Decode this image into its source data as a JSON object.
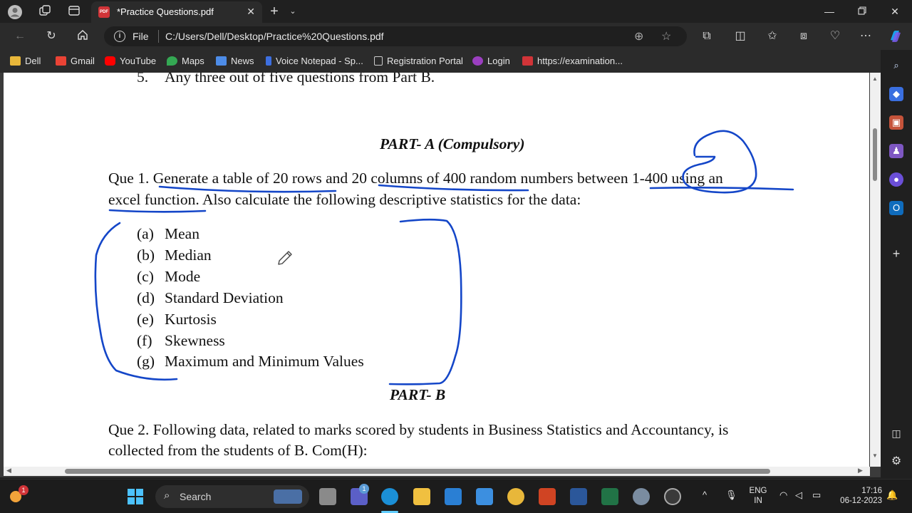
{
  "browser": {
    "tab_title": "*Practice Questions.pdf",
    "address_scheme_label": "File",
    "address_url": "C:/Users/Dell/Desktop/Practice%20Questions.pdf",
    "bookmarks": [
      "Dell",
      "Gmail",
      "YouTube",
      "Maps",
      "News",
      "Voice Notepad - Sp...",
      "Registration Portal",
      "Login",
      "https://examination..."
    ]
  },
  "document": {
    "instruction_5_num": "5.",
    "instruction_5_text": "Any three out of five questions from Part B.",
    "part_a_heading": "PART- A (Compulsory)",
    "q1_line1": "Que 1. Generate a table of 20 rows and 20 columns of 400 random numbers between 1-400 using an",
    "q1_line2": "excel function. Also calculate the following descriptive statistics for the data:",
    "q1_items": [
      {
        "label": "(a)",
        "text": "Mean"
      },
      {
        "label": "(b)",
        "text": "Median"
      },
      {
        "label": "(c)",
        "text": "Mode"
      },
      {
        "label": "(d)",
        "text": "Standard Deviation"
      },
      {
        "label": "(e)",
        "text": "Kurtosis"
      },
      {
        "label": "(f)",
        "text": "Skewness"
      },
      {
        "label": "(g)",
        "text": "Maximum and Minimum Values"
      }
    ],
    "part_b_heading": "PART- B",
    "q2_line1": "Que 2. Following data, related to marks scored by students in Business Statistics and Accountancy, is",
    "q2_line2": "collected from the students of B. Com(H):"
  },
  "taskbar": {
    "search_label": "Search",
    "language_line1": "ENG",
    "language_line2": "IN",
    "time": "17:16",
    "date": "06-12-2023",
    "widget_badge": "1",
    "teams_badge": "1"
  },
  "colors": {
    "ink": "#1446c8",
    "edge_accent": "#0b57d0"
  }
}
